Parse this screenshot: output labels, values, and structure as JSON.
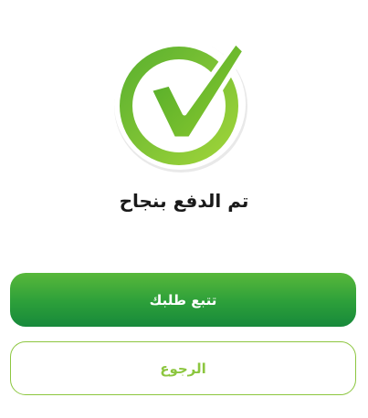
{
  "icons": {
    "success": "check-circle-icon"
  },
  "colors": {
    "accent_green": "#8cc63f",
    "button_green_top": "#58b83a",
    "button_green_bottom": "#17893b",
    "message_text": "#1a1a1a"
  },
  "status": {
    "message": "تم الدفع بنجاح"
  },
  "actions": {
    "track_order_label": "تتبع طلبك",
    "back_label": "الرجوع"
  }
}
